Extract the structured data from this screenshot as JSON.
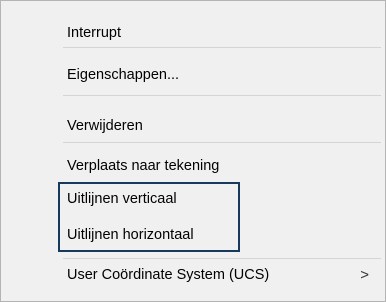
{
  "menu": {
    "items": [
      {
        "label": "Interrupt"
      },
      {
        "label": "Eigenschappen..."
      },
      {
        "label": "Verwijderen"
      },
      {
        "label": "Verplaats naar tekening"
      },
      {
        "label": "Uitlijnen verticaal"
      },
      {
        "label": "Uitlijnen horizontaal"
      },
      {
        "label": "User Coördinate System (UCS)",
        "submenu_glyph": ">"
      }
    ]
  },
  "colors": {
    "menu_background": "#f0f0f0",
    "separator": "#d4d4d4",
    "highlight_border": "#17395e",
    "text": "#000000"
  }
}
